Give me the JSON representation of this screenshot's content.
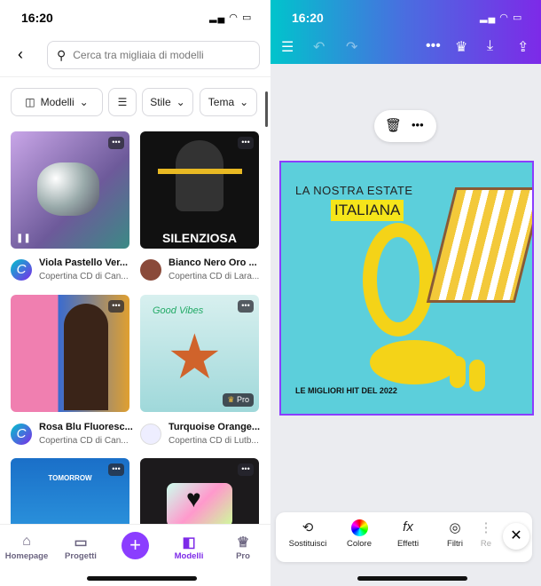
{
  "left": {
    "status_time": "16:20",
    "search_placeholder": "Cerca tra migliaia di modelli",
    "filters": [
      {
        "label": "Modelli"
      },
      {
        "label": "Stile"
      },
      {
        "label": "Tema"
      }
    ],
    "cards": [
      {
        "title": "Viola Pastello Ver...",
        "subtitle": "Copertina CD di Can..."
      },
      {
        "title": "Bianco Nero Oro ...",
        "subtitle": "Copertina CD di Lara...",
        "image_text": "SILENZIOSA"
      },
      {
        "title": "Rosa Blu Fluoresc...",
        "subtitle": "Copertina CD di Can..."
      },
      {
        "title": "Turquoise Orange...",
        "subtitle": "Copertina CD di Lutb...",
        "image_text": "Good Vibes",
        "badge": "Pro"
      },
      {
        "image_text": "TOMORROW"
      },
      {}
    ],
    "nav": [
      {
        "label": "Homepage"
      },
      {
        "label": "Progetti"
      },
      {
        "label": "Modelli",
        "active": true
      },
      {
        "label": "Pro"
      }
    ],
    "accent": "#8b3dff"
  },
  "right": {
    "status_time": "16:20",
    "design": {
      "line1": "LA NOSTRA ESTATE",
      "line2": "ITALIANA",
      "footer": "LE MIGLIORI HIT DEL 2022"
    },
    "toolbar": [
      {
        "label": "Sostituisci"
      },
      {
        "label": "Colore"
      },
      {
        "label": "Effetti"
      },
      {
        "label": "Filtri"
      },
      {
        "label": "Re"
      }
    ],
    "header_gradient": [
      "#00c4cc",
      "#7d2ae8"
    ]
  }
}
